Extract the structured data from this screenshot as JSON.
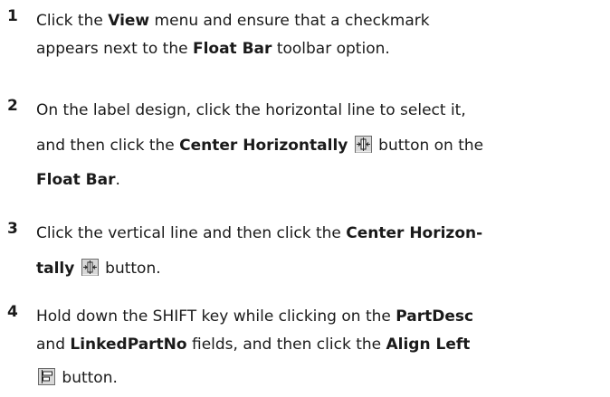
{
  "steps": [
    {
      "number": "1",
      "lines": [
        [
          "Click the ",
          {
            "b": "View"
          },
          " menu and ensure that a checkmark"
        ],
        [
          "appears next to the ",
          {
            "b": "Float Bar"
          },
          " toolbar option."
        ]
      ]
    },
    {
      "number": "2",
      "lines": [
        [
          "On the label design, click the horizontal line to select it,"
        ],
        [
          "and then click the ",
          {
            "b": "Center Horizontally"
          },
          " ",
          {
            "icon": "center-horizontally-icon"
          },
          " button on the"
        ],
        [
          {
            "b": "Float Bar"
          },
          "."
        ]
      ]
    },
    {
      "number": "3",
      "lines": [
        [
          "Click the vertical line and then click the ",
          {
            "b": "Center Horizon-"
          }
        ],
        [
          {
            "b": "tally"
          },
          " ",
          {
            "icon": "center-horizontally-icon"
          },
          " button."
        ]
      ]
    },
    {
      "number": "4",
      "lines": [
        [
          "Hold down the SHIFT key while clicking on the ",
          {
            "b": "PartDesc"
          }
        ],
        [
          "and ",
          {
            "b": "LinkedPartNo"
          },
          " fields, and then click the ",
          {
            "b": "Align Left"
          }
        ],
        [
          {
            "icon": "align-left-icon"
          },
          " button."
        ]
      ]
    }
  ]
}
